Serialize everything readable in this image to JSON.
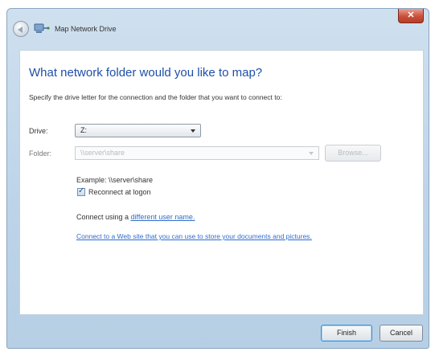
{
  "window": {
    "title": "Map Network Drive",
    "close_glyph": "✕"
  },
  "icons": {
    "back": "back-arrow-icon",
    "network": "network-drive-icon",
    "close": "close-icon",
    "checkbox_check": "✓"
  },
  "main": {
    "heading": "What network folder would you like to map?",
    "instruction": "Specify the drive letter for the connection and the folder that you want to connect to:",
    "drive_label": "Drive:",
    "drive_value": "Z:",
    "folder_label": "Folder:",
    "folder_value": "\\\\server\\share",
    "browse_label": "Browse...",
    "example": "Example: \\\\server\\share",
    "reconnect_label": "Reconnect at logon",
    "reconnect_checked": true,
    "connect_using_prefix": "Connect using a ",
    "connect_using_link": "different user name.",
    "web_link": "Connect to a Web site that you can use to store your documents and pictures."
  },
  "footer": {
    "finish_label": "Finish",
    "cancel_label": "Cancel"
  },
  "colors": {
    "heading": "#1e4fa8",
    "link": "#2f6dcc",
    "frame": "#bcd3e8",
    "close": "#c9513c"
  }
}
